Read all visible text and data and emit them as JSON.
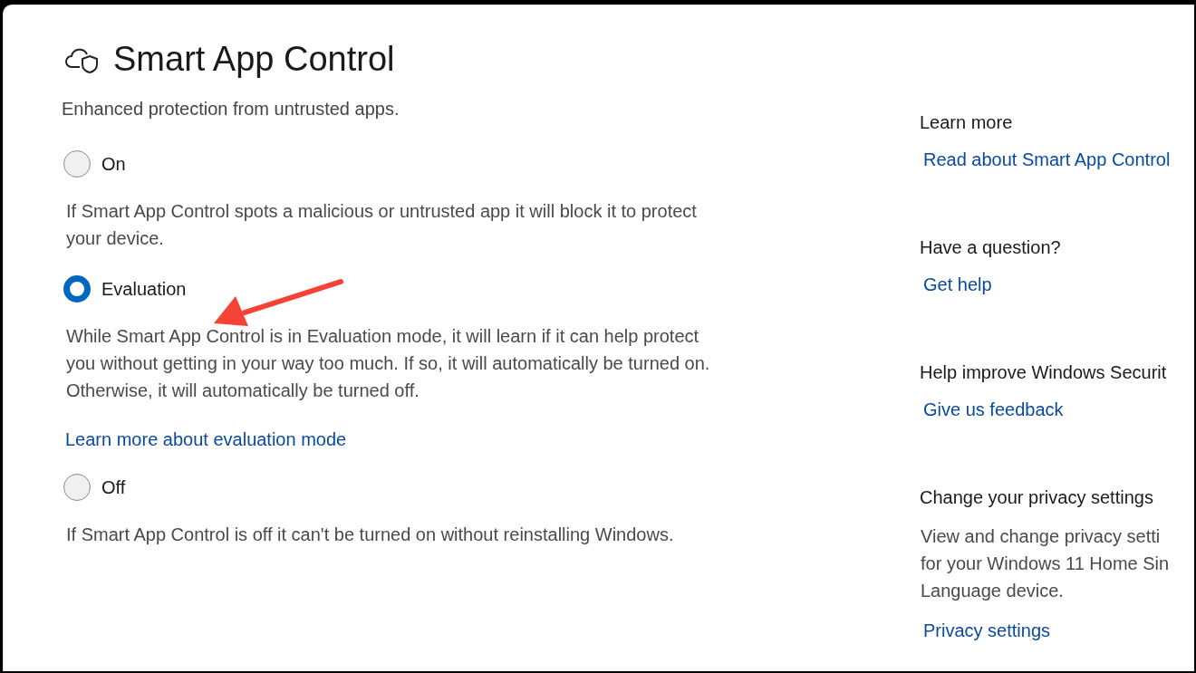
{
  "header": {
    "title": "Smart App Control",
    "subtitle": "Enhanced protection from untrusted apps."
  },
  "options": [
    {
      "label": "On",
      "selected": false,
      "description": "If Smart App Control spots a malicious or untrusted app it will block it to protect your device."
    },
    {
      "label": "Evaluation",
      "selected": true,
      "description": "While Smart App Control is in Evaluation mode, it will learn if it can help protect you without getting in your way too much. If so, it will automatically be turned on. Otherwise, it will automatically be turned off.",
      "link": "Learn more about evaluation mode"
    },
    {
      "label": "Off",
      "selected": false,
      "description": "If Smart App Control is off it can't be turned on without reinstalling Windows."
    }
  ],
  "sidebar": [
    {
      "heading": "Learn more",
      "link": "Read about Smart App Control"
    },
    {
      "heading": "Have a question?",
      "link": "Get help"
    },
    {
      "heading": "Help improve Windows Securit",
      "link": "Give us feedback"
    },
    {
      "heading": "Change your privacy settings",
      "text_lines": [
        "View and change privacy setti",
        "for your Windows 11 Home Sin",
        "Language device."
      ],
      "link": "Privacy settings"
    }
  ]
}
